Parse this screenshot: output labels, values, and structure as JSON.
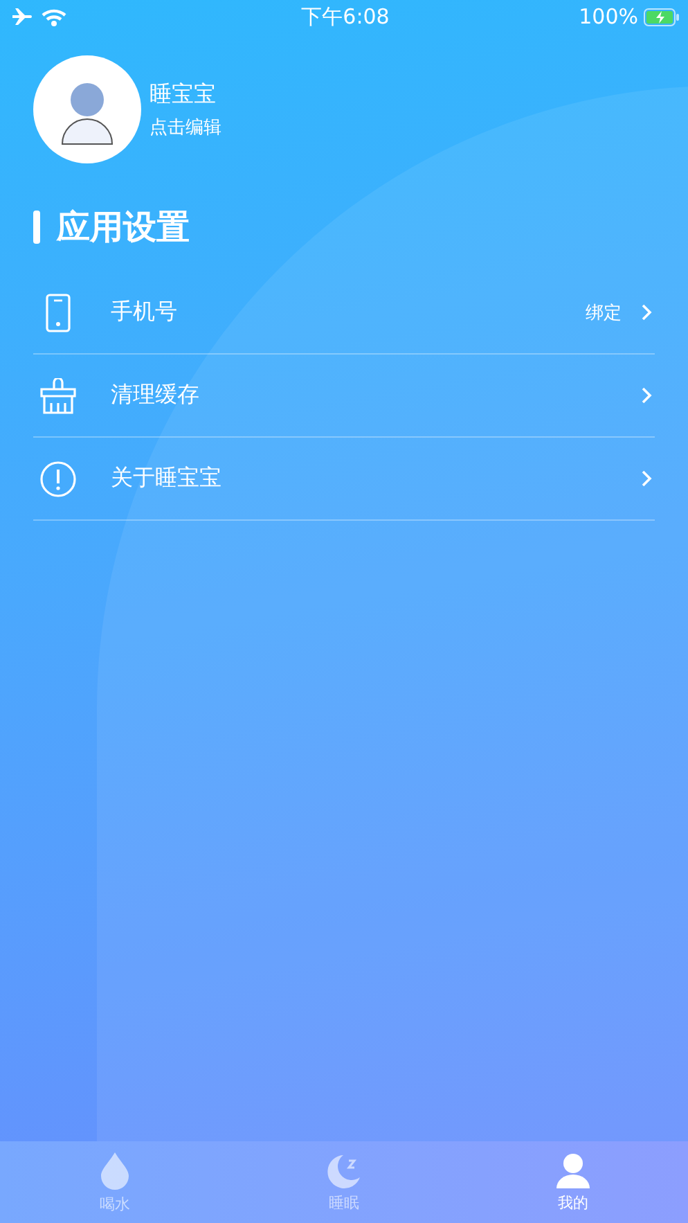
{
  "status_bar": {
    "time": "下午6:08",
    "battery": "100%"
  },
  "profile": {
    "name": "睡宝宝",
    "hint": "点击编辑"
  },
  "section": {
    "title": "应用设置"
  },
  "settings": [
    {
      "kind": "phone",
      "label": "手机号",
      "value": "绑定"
    },
    {
      "kind": "clean",
      "label": "清理缓存"
    },
    {
      "kind": "about",
      "label": "关于睡宝宝"
    }
  ],
  "tabs": [
    {
      "kind": "water",
      "label": "喝水",
      "selected": false
    },
    {
      "kind": "sleep",
      "label": "睡眠",
      "selected": false
    },
    {
      "kind": "me",
      "label": "我的",
      "selected": true
    }
  ]
}
